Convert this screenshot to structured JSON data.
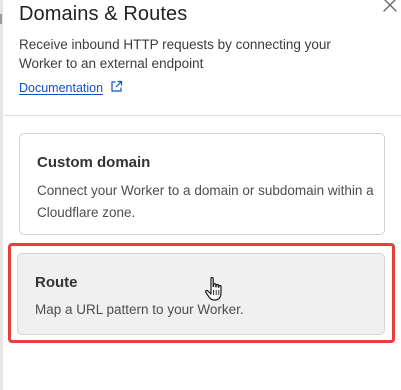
{
  "panel": {
    "title": "Domains & Routes",
    "subtitle": "Receive inbound HTTP requests by connecting your Worker to an external endpoint",
    "documentation_link": "Documentation",
    "close_icon": "close-icon",
    "external_link_icon": "external-link-icon"
  },
  "options": [
    {
      "title": "Custom domain",
      "description": "Connect your Worker to a domain or subdomain within a Cloudflare zone.",
      "state": "default"
    },
    {
      "title": "Route",
      "description": "Map a URL pattern to your Worker.",
      "state": "hovered"
    }
  ],
  "cursor": "hand-pointer-cursor",
  "colors": {
    "link": "#0a53c7",
    "highlight": "#e53f3f",
    "hover_card_bg": "#f0f0f0"
  }
}
